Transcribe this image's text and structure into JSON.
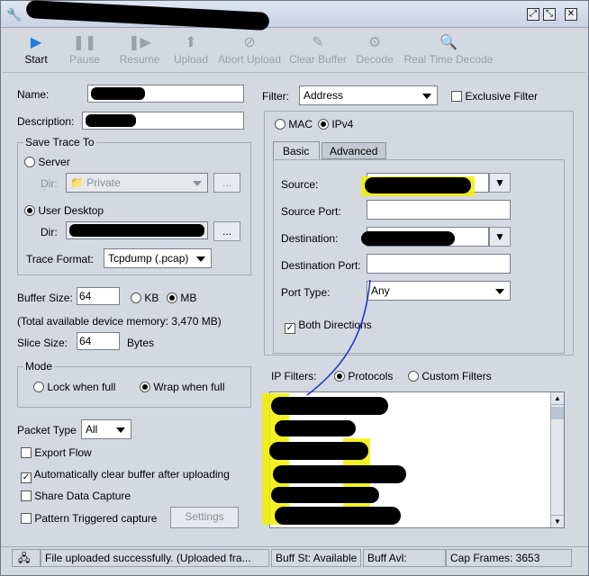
{
  "toolbar": {
    "start": "Start",
    "pause": "Pause",
    "resume": "Resume",
    "upload": "Upload",
    "abort_upload": "Abort Upload",
    "clear_buffer": "Clear Buffer",
    "decode": "Decode",
    "real_time_decode": "Real Time Decode"
  },
  "form": {
    "name_label": "Name:",
    "description_label": "Description:",
    "save_trace_to": "Save Trace To",
    "server_label": "Server",
    "dir_label": "Dir:",
    "server_dir_value": "Private",
    "browse_label": "...",
    "user_desktop_label": "User Desktop",
    "trace_format_label": "Trace Format:",
    "trace_format_value": "Tcpdump (.pcap)",
    "buffer_size_label": "Buffer Size:",
    "buffer_size_value": "64",
    "kb_label": "KB",
    "mb_label": "MB",
    "memory_note": "(Total available device memory: 3,470 MB)",
    "slice_size_label": "Slice Size:",
    "slice_size_value": "64",
    "bytes_label": "Bytes",
    "mode_label": "Mode",
    "lock_when_full": "Lock when full",
    "wrap_when_full": "Wrap when full",
    "packet_type_label": "Packet Type",
    "packet_type_value": "All",
    "export_flow": "Export Flow",
    "auto_clear": "Automatically clear buffer after uploading",
    "share_data": "Share Data Capture",
    "pattern_triggered": "Pattern Triggered capture",
    "settings_button": "Settings"
  },
  "filter": {
    "filter_label": "Filter:",
    "filter_value": "Address",
    "exclusive_filter": "Exclusive Filter",
    "mac_label": "MAC",
    "ipv4_label": "IPv4",
    "tab_basic": "Basic",
    "tab_advanced": "Advanced",
    "source_label": "Source:",
    "source_port_label": "Source Port:",
    "destination_label": "Destination:",
    "destination_port_label": "Destination Port:",
    "port_type_label": "Port Type:",
    "port_type_value": "Any",
    "both_directions": "Both Directions",
    "ip_filters_label": "IP Filters:",
    "protocols_label": "Protocols",
    "custom_filters_label": "Custom Filters"
  },
  "status": {
    "message": "File uploaded successfully. (Uploaded fra...",
    "buff_st": "Buff St: Available",
    "buff_avl": "Buff Avl:",
    "cap_frames": "Cap Frames: 3653"
  },
  "colors": {
    "highlight": "#f2f000",
    "accent": "#1e7fd8"
  }
}
